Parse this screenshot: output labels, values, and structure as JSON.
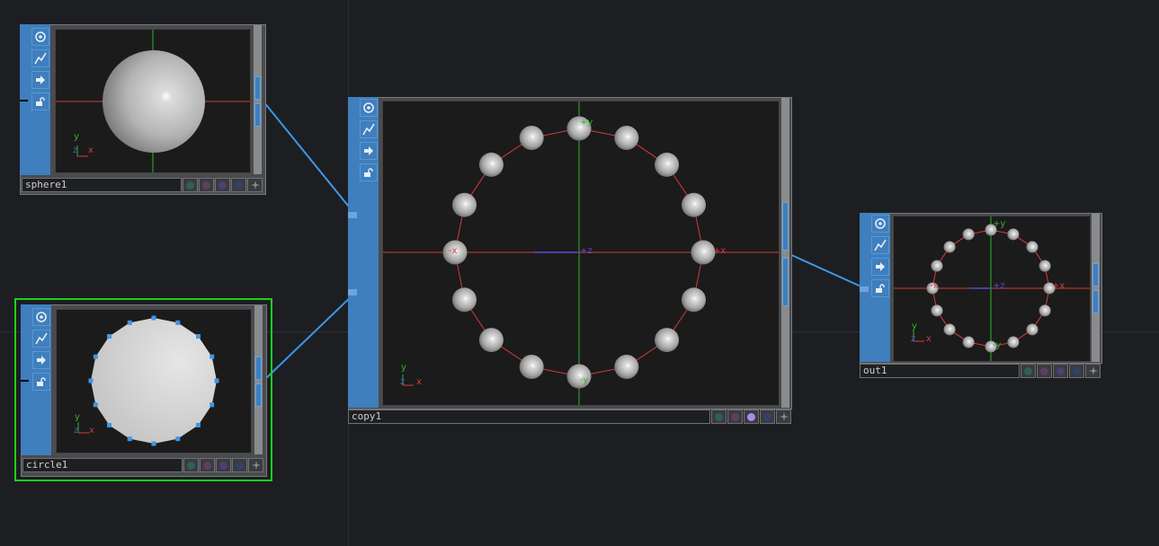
{
  "colors": {
    "background": "#1d1e21",
    "wire": "#3d97e6",
    "selection": "#1bd11b",
    "node_strip": "#3f7fbd",
    "x_axis": "#d23b3b",
    "y_axis": "#2bb52b",
    "z_axis": "#5b4bd0"
  },
  "viewer_buttons": [
    {
      "name": "display-icon"
    },
    {
      "name": "wave-icon"
    },
    {
      "name": "arrow-right-icon"
    },
    {
      "name": "lock-icon"
    }
  ],
  "flag_colors": [
    "#2f5f55",
    "#5f3f5f",
    "#4b3f73",
    "#33416a",
    "#555658"
  ],
  "nodes": {
    "sphere1": {
      "name": "sphere1",
      "axis_y": "y",
      "axis_z": "z",
      "axis_x": "x",
      "selected": false
    },
    "circle1": {
      "name": "circle1",
      "axis_y": "y",
      "axis_z": "z",
      "axis_x": "x",
      "selected": true
    },
    "copy1": {
      "name": "copy1",
      "axis_y": "y",
      "axis_z": "z",
      "axis_x": "x",
      "label_py": "+y",
      "label_ny": "-y",
      "label_px": "+x",
      "label_nx": "-x",
      "label_pz": "+z",
      "copies": 16,
      "active_flag": 2
    },
    "out1": {
      "name": "out1",
      "axis_y": "y",
      "axis_z": "z",
      "axis_x": "x",
      "label_py": "+y",
      "label_ny": "-y",
      "label_px": "+x",
      "label_nx": "-x",
      "label_pz": "+z",
      "copies": 16
    }
  }
}
